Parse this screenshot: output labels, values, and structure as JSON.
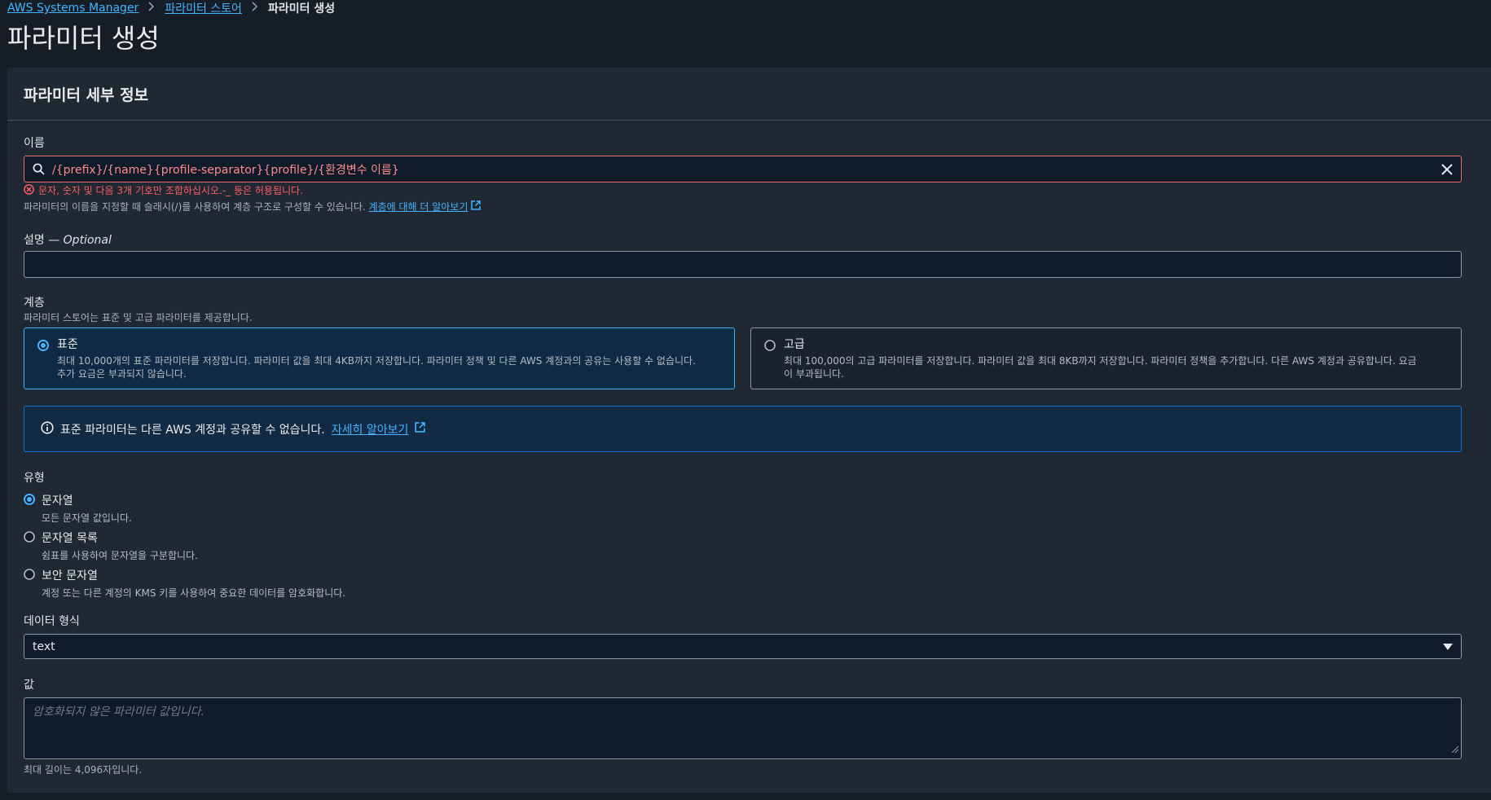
{
  "breadcrumb": {
    "items": [
      "AWS Systems Manager",
      "파라미터 스토어"
    ],
    "current": "파라미터 생성"
  },
  "page_title": "파라미터 생성",
  "panel": {
    "title": "파라미터 세부 정보"
  },
  "name_field": {
    "label": "이름",
    "value": "/{prefix}/{name}{profile-separator}{profile}/{환경변수 이름}",
    "error": "문자, 숫자 및 다음 3개 기호만 조합하십시오.-_ 등은 허용됩니다.",
    "hint": "파라미터의 이름을 지정할 때 슬래시(/)를 사용하여 계층 구조로 구성할 수 있습니다.",
    "hint_link": "계층에 대해 더 알아보기"
  },
  "description_field": {
    "label": "설명",
    "optional": " — Optional",
    "value": ""
  },
  "tier": {
    "label": "계층",
    "hint": "파라미터 스토어는 표준 및 고급 파라미터를 제공합니다.",
    "options": [
      {
        "title": "표준",
        "desc1": "최대 10,000개의 표준 파라미터를 저장합니다. 파라미터 값을 최대 4KB까지 저장합니다. 파라미터 정책 및 다른 AWS 계정과의 공유는 사용할 수 없습니다.",
        "desc2": "추가 요금은 부과되지 않습니다.",
        "selected": true
      },
      {
        "title": "고급",
        "desc1": "최대 100,000의 고급 파라미터를 저장합니다. 파라미터 값을 최대 8KB까지 저장합니다. 파라미터 정책을 추가합니다. 다른 AWS 계정과 공유합니다. 요금",
        "desc2": "이 부과됩니다.",
        "selected": false
      }
    ]
  },
  "info": {
    "text": "표준 파라미터는 다른 AWS 계정과 공유할 수 없습니다.",
    "link": "자세히 알아보기"
  },
  "type": {
    "label": "유형",
    "options": [
      {
        "title": "문자열",
        "desc": "모든 문자열 값입니다.",
        "selected": true
      },
      {
        "title": "문자열 목록",
        "desc": "쉼표를 사용하여 문자열을 구분합니다.",
        "selected": false
      },
      {
        "title": "보안 문자열",
        "desc": "계정 또는 다른 계정의 KMS 키를 사용하여 중요한 데이터를 암호화합니다.",
        "selected": false
      }
    ]
  },
  "data_format": {
    "label": "데이터 형식",
    "selected": "text"
  },
  "value_field": {
    "label": "값",
    "placeholder": "암호화되지 않은 파라미터 값입니다.",
    "hint": "최대 길이는 4,096자입니다."
  },
  "colors": {
    "accent": "#42b4ff",
    "error": "#ff5d64",
    "background": "#161d26",
    "panel": "#1f2833"
  }
}
